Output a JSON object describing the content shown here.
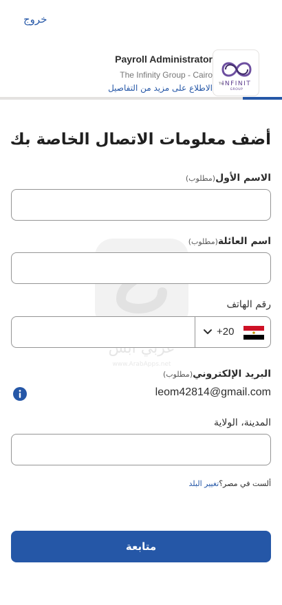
{
  "header": {
    "exit_label": "خروج"
  },
  "job": {
    "title": "Payroll Administrator",
    "company": "The Infinity Group - Cairo",
    "details_link": "الاطلاع على مزيد من التفاصيل",
    "logo_text": "INFINIT",
    "logo_subtext": "GROUP",
    "logo_prefix": "The"
  },
  "progress": {
    "fraction": 0.14
  },
  "form": {
    "title": "أضف معلومات الاتصال الخاصة بك",
    "required_text": "(مطلوب)",
    "first_name": {
      "label": "الاسم الأول",
      "required": true,
      "value": ""
    },
    "last_name": {
      "label": "اسم العائلة",
      "required": true,
      "value": ""
    },
    "phone": {
      "label": "رقم الهاتف",
      "country_code": "+20",
      "flag": "egypt-flag-icon",
      "value": ""
    },
    "email": {
      "label": "البريد الإلكتروني",
      "required": true,
      "value": "leom42814@gmail.com",
      "info_icon": "info-icon"
    },
    "city": {
      "label": "المدينة، الولاية",
      "value": ""
    },
    "country_note": "ألست في مصر؟",
    "change_country": "تغيير البلد",
    "continue_label": "متابعة"
  },
  "watermark": {
    "text": "عربي آبس",
    "url": "www.ArabApps.net"
  },
  "colors": {
    "accent": "#2557a7",
    "border": "#949494",
    "text": "#2d2d2d",
    "logo_purple": "#5b3a8c"
  }
}
